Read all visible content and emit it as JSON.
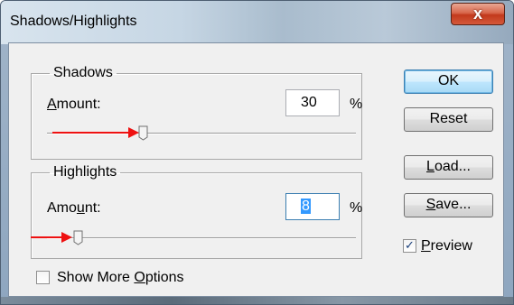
{
  "window": {
    "title": "Shadows/Highlights",
    "close_label": "x"
  },
  "shadows": {
    "legend": "Shadows",
    "amount_label": {
      "pre": "",
      "key": "A",
      "post": "mount:"
    },
    "amount_value": "30",
    "unit": "%",
    "slider_value_percent": 30
  },
  "highlights": {
    "legend": "Highlights",
    "amount_label": {
      "pre": "Amo",
      "key": "u",
      "post": "nt:"
    },
    "amount_value": "8",
    "unit": "%",
    "slider_value_percent": 8
  },
  "buttons": {
    "ok": "OK",
    "reset": "Reset",
    "load": {
      "pre": "",
      "key": "L",
      "post": "oad..."
    },
    "save": {
      "pre": "",
      "key": "S",
      "post": "ave..."
    }
  },
  "preview": {
    "pre": "",
    "key": "P",
    "post": "review",
    "checked": true,
    "check_glyph": "✓"
  },
  "show_more": {
    "pre": "Show More ",
    "key": "O",
    "post": "ptions",
    "checked": false
  },
  "colors": {
    "annotation_arrow": "#ee1111",
    "selection": "#3399ff"
  }
}
